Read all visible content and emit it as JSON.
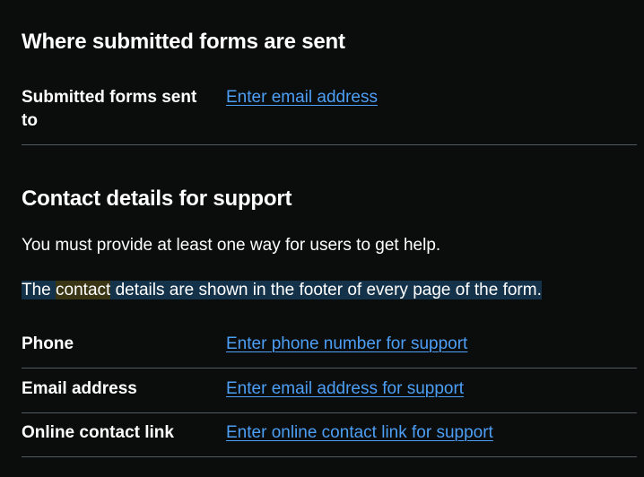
{
  "submission": {
    "heading": "Where submitted forms are sent",
    "row_key": "Submitted forms sent to",
    "row_link": "Enter email address"
  },
  "support": {
    "heading": "Contact details for support",
    "intro": "You must provide at least one way for users to get help.",
    "note_part1": "The ",
    "note_part2": "contact",
    "note_part3": " details are shown in the footer of every page of the form.",
    "rows": [
      {
        "key": "Phone",
        "link": "Enter phone number for support"
      },
      {
        "key": "Email address",
        "link": "Enter email address for support"
      },
      {
        "key": "Online contact link",
        "link": "Enter online contact link for support"
      }
    ]
  },
  "colors": {
    "background": "#0b0c0c",
    "text": "#ffffff",
    "link": "#4d9ff5",
    "divider": "#505a5f",
    "selection": "#14324a",
    "search_highlight": "#3a3514"
  }
}
